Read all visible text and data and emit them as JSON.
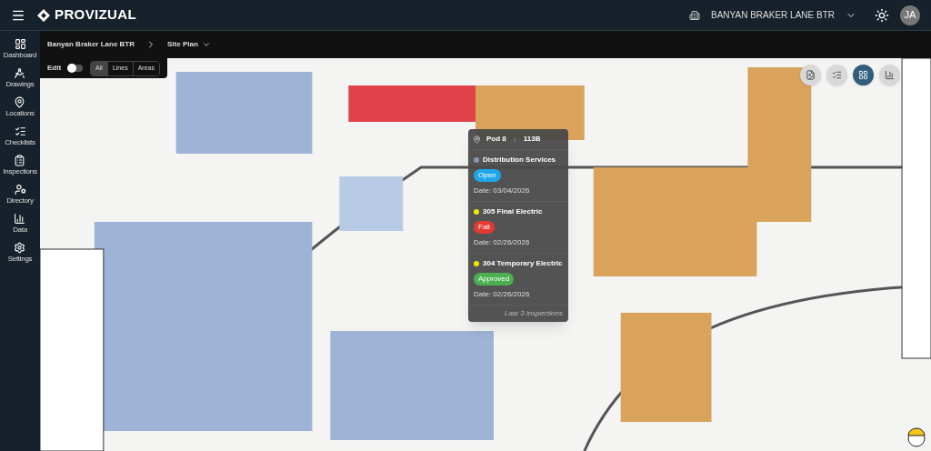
{
  "header": {
    "brand": "PROVIZUAL",
    "project": "BANYAN BRAKER LANE BTR",
    "avatar": "JA"
  },
  "sidebar": {
    "items": [
      {
        "label": "Dashboard",
        "kind": "dashboard"
      },
      {
        "label": "Drawings",
        "kind": "drawings"
      },
      {
        "label": "Locations",
        "kind": "locations"
      },
      {
        "label": "Checklists",
        "kind": "checklists"
      },
      {
        "label": "Inspections",
        "kind": "inspections"
      },
      {
        "label": "Directory",
        "kind": "directory"
      },
      {
        "label": "Data",
        "kind": "data"
      },
      {
        "label": "Settings",
        "kind": "settings"
      }
    ]
  },
  "breadcrumb": [
    "Banyan Braker Lane BTR",
    "Site Plan"
  ],
  "edit": {
    "label": "Edit",
    "on": false
  },
  "filters": [
    {
      "label": "All",
      "selected": true
    },
    {
      "label": "Lines",
      "selected": false
    },
    {
      "label": "Areas",
      "selected": false
    }
  ],
  "map_tools": [
    {
      "kind": "pdf",
      "selected": false
    },
    {
      "kind": "checklist",
      "selected": false
    },
    {
      "kind": "grid",
      "selected": true
    },
    {
      "kind": "chart",
      "selected": false
    }
  ],
  "popup": {
    "pod": "Pod 8",
    "unit": "113B",
    "inspections": [
      {
        "title": "Distribution Services",
        "color": "#8a9aa8",
        "badge": {
          "label": "Open",
          "color": "#1ea7e8"
        },
        "date": "Date: 03/04/2026"
      },
      {
        "title": "305 Final Electric",
        "color": "#f2e600",
        "badge": {
          "label": "Fail",
          "color": "#e53935"
        },
        "date": "Date: 02/26/2026"
      },
      {
        "title": "304 Temporary Electric",
        "color": "#f2e600",
        "badge": {
          "label": "Approved",
          "color": "#4caf50"
        },
        "date": "Date: 02/26/2026"
      }
    ],
    "footer": "Last 3 inspections"
  }
}
